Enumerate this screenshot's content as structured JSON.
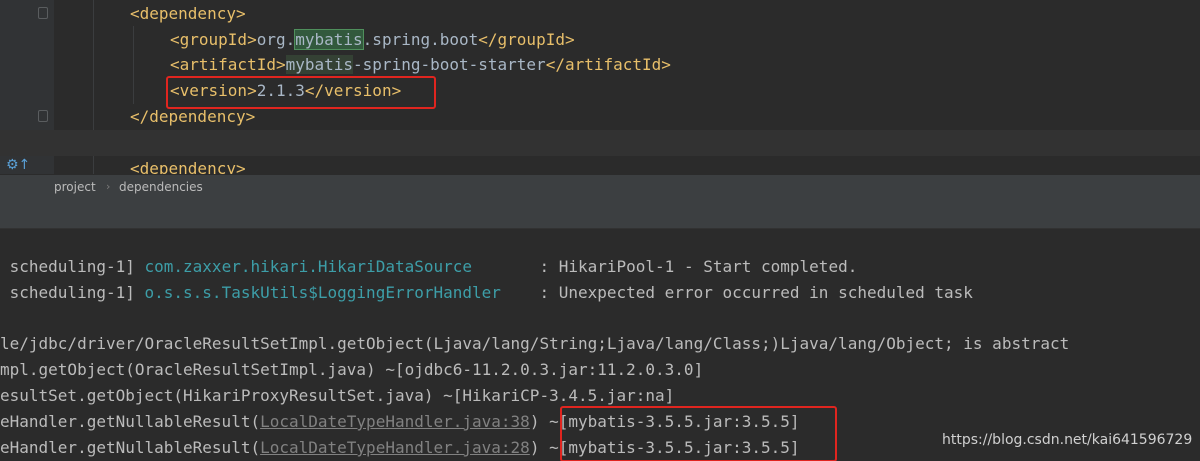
{
  "editor": {
    "lines": [
      {
        "tag_open": "<dependency>"
      },
      {
        "tag_open": "<groupId>",
        "pre": "org.",
        "hl": "mybatis",
        "post": ".spring.boot",
        "tag_close": "</groupId>"
      },
      {
        "tag_open": "<artifactId>",
        "hl": "mybatis",
        "post": "-spring-boot-starter",
        "tag_close": "</artifactId>"
      },
      {
        "tag_open": "<version>",
        "post": "2.1.3",
        "tag_close": "</version>"
      },
      {
        "tag_close": "</dependency>"
      },
      {},
      {
        "tag_open": "<dependency>"
      }
    ]
  },
  "breadcrumb": {
    "items": [
      "project",
      "dependencies"
    ]
  },
  "console": {
    "lines": [
      {
        "thread": " scheduling-1] ",
        "logger": "com.zaxxer.hikari.HikariDataSource",
        "pad": "       ",
        "message": ": HikariPool-1 - Start completed."
      },
      {
        "thread": " scheduling-1] ",
        "logger": "o.s.s.s.TaskUtils$LoggingErrorHandler",
        "pad": "    ",
        "message": ": Unexpected error occurred in scheduled task"
      },
      {
        "text": ""
      },
      {
        "text": "le/jdbc/driver/OracleResultSetImpl.getObject(Ljava/lang/String;Ljava/lang/Class;)Ljava/lang/Object; is abstract"
      },
      {
        "text": "mpl.getObject(OracleResultSetImpl.java) ~[ojdbc6-11.2.0.3.jar:11.2.0.3.0]"
      },
      {
        "text": "esultSet.getObject(HikariProxyResultSet.java) ~[HikariCP-3.4.5.jar:na]"
      },
      {
        "pre": "eHandler.getNullableResult(",
        "link": "LocalDateTypeHandler.java:38",
        "post": ") ~[mybatis-3.5.5.jar:3.5.5]"
      },
      {
        "pre": "eHandler.getNullableResult(",
        "link": "LocalDateTypeHandler.java:28",
        "post": ") ~[mybatis-3.5.5.jar:3.5.5]"
      }
    ]
  },
  "watermark": "https://blog.csdn.net/kai641596729"
}
